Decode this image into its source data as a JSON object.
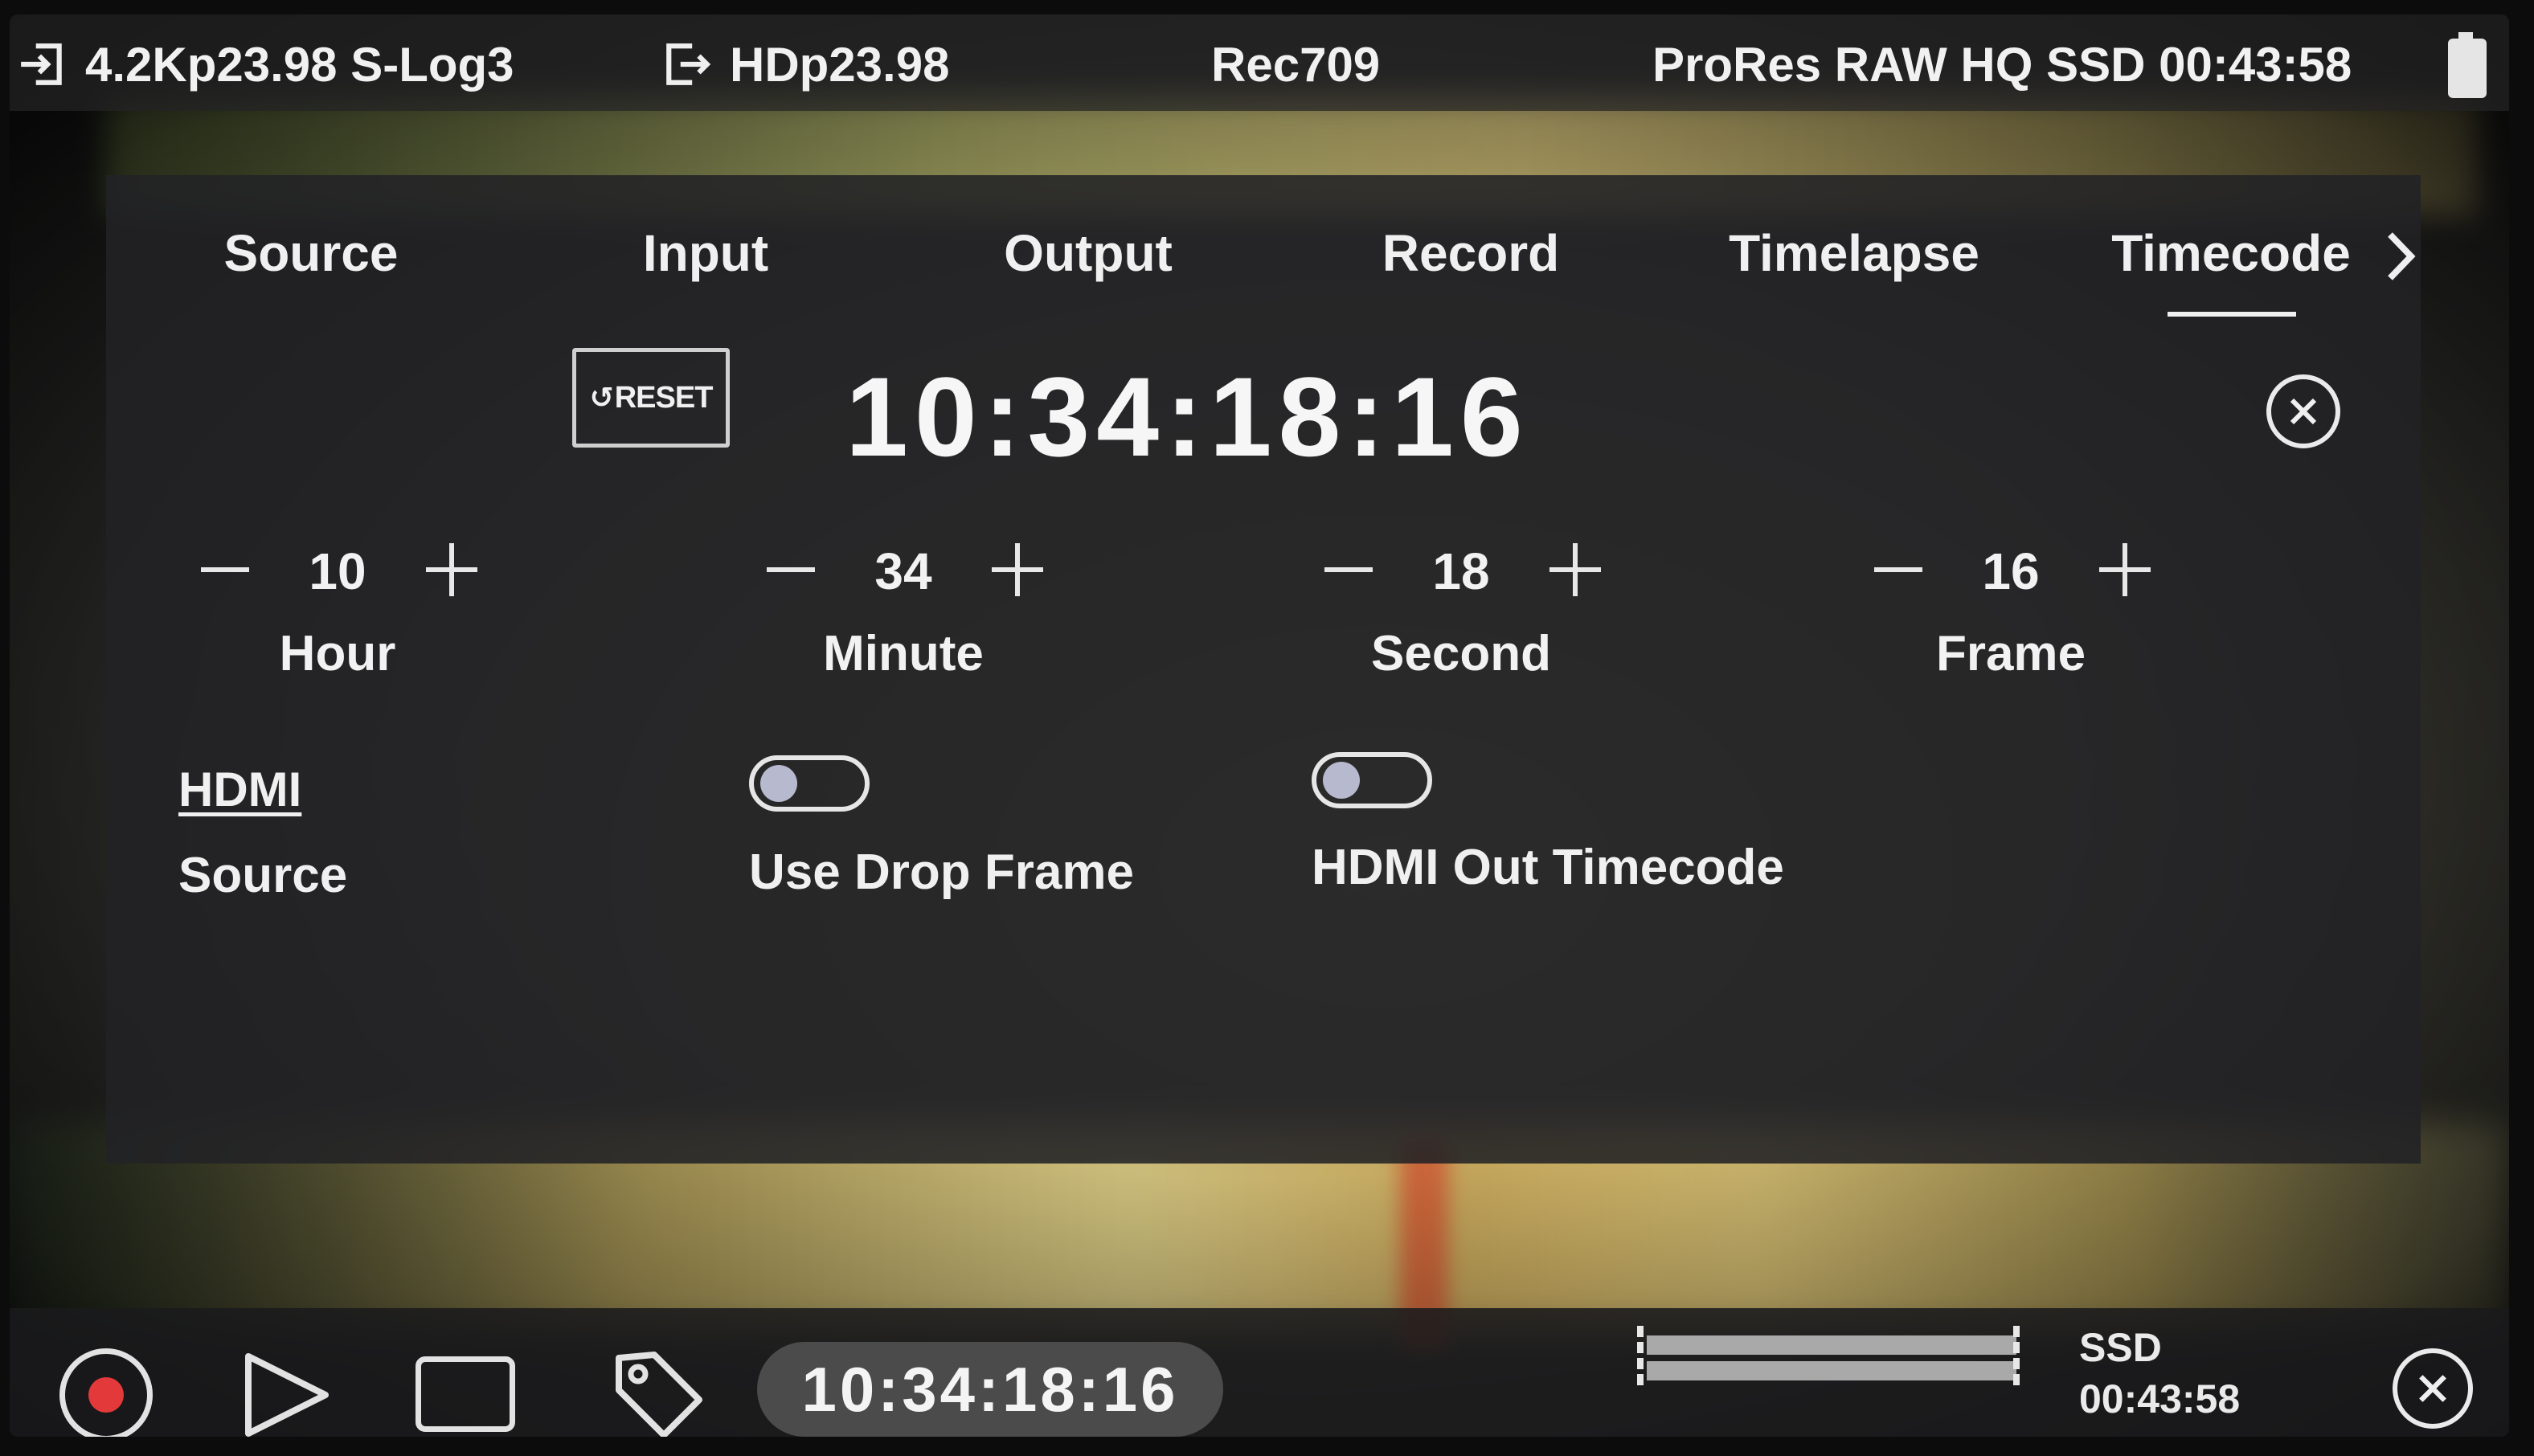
{
  "topbar": {
    "input_format": "4.2Kp23.98 S-Log3",
    "output_format": "HDp23.98",
    "lut": "Rec709",
    "record_status": "ProRes RAW HQ SSD 00:43:58"
  },
  "tabs": [
    {
      "label": "Source"
    },
    {
      "label": "Input"
    },
    {
      "label": "Output"
    },
    {
      "label": "Record"
    },
    {
      "label": "Timelapse"
    },
    {
      "label": "Timecode",
      "active": true
    }
  ],
  "timecode_panel": {
    "reset_label": "RESET",
    "timecode": "10:34:18:16",
    "fields": [
      {
        "value": "10",
        "label": "Hour"
      },
      {
        "value": "34",
        "label": "Minute"
      },
      {
        "value": "18",
        "label": "Second"
      },
      {
        "value": "16",
        "label": "Frame"
      }
    ],
    "source_value": "HDMI",
    "source_label": "Source",
    "toggles": [
      {
        "label": "Use Drop Frame",
        "on": false
      },
      {
        "label": "HDMI Out Timecode",
        "on": false
      }
    ]
  },
  "bottombar": {
    "timecode": "10:34:18:16",
    "media": "SSD",
    "remaining": "00:43:58"
  },
  "icons": [
    "input-icon",
    "output-icon",
    "battery-icon",
    "chevron-right-icon",
    "reset-icon",
    "close-icon",
    "record-icon",
    "play-icon",
    "stop-icon",
    "tag-icon",
    "audio-meter-icon"
  ]
}
